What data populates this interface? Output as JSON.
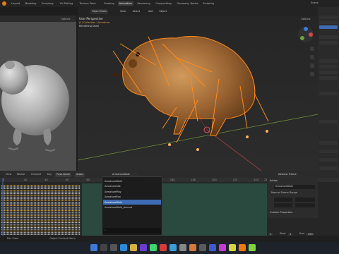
{
  "topbar": {
    "tabs": [
      "Layout",
      "Modeling",
      "Sculpting",
      "UV Editing",
      "Texture Paint",
      "Shading",
      "Animation",
      "Rendering",
      "Compositing",
      "Geometry Nodes",
      "Scripting"
    ],
    "active_tab": "Animation",
    "scene_label": "Scene"
  },
  "viewport": {
    "perspective": "User Perspective",
    "collection": "(1) Collection | Armature",
    "render_status": "Rendering Done",
    "mode": "Object Mode",
    "menus": [
      "View",
      "Select",
      "Add",
      "Object"
    ],
    "options_label": "Options"
  },
  "left_view": {
    "options_label": "Options"
  },
  "timeline": {
    "menus": [
      "View",
      "Marker",
      "Channel",
      "Key"
    ],
    "push_down": "Push Down",
    "stash": "Stash",
    "action_name": "ArmatureWalk",
    "frames": [
      "0",
      "20",
      "40",
      "60",
      "80",
      "100",
      "120",
      "140",
      "160",
      "180",
      "200",
      "220",
      "240",
      "250"
    ],
    "current_frame": "1",
    "start_label": "Start",
    "start_value": "1",
    "end_label": "End",
    "end_value": "250",
    "nearest_frame": "Nearest Frame"
  },
  "action_popup": {
    "items": [
      "ArmatureWalk",
      "ArmatureIdle",
      "ArmaturePlay",
      "ArmatureRun",
      "ArmatureWalk",
      "ArmatureWalk_Around"
    ],
    "selected_index": 4
  },
  "action_panel": {
    "section": "Action",
    "action_name": "ArmatureWalk",
    "manual_range": "Manual Frame Range",
    "custom_props": "Custom Properties"
  },
  "status": {
    "left": "Pan View",
    "right": "Object Context Menu"
  },
  "colors": {
    "accent": "#e87d0d",
    "selection": "#3e6bb3",
    "keyframe": "#d9a23a",
    "bone_orange": "#ff8a1a"
  }
}
